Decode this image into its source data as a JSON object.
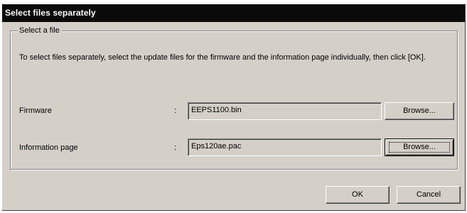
{
  "window": {
    "title": "Select files separately"
  },
  "group": {
    "legend": "Select a file"
  },
  "instruction": "To select files separately, select the update files for the firmware and the information page individually, then click [OK].",
  "rows": [
    {
      "label": "Firmware",
      "colon": ":",
      "value": "EEPS1100.bin",
      "browse_label": "Browse..."
    },
    {
      "label": "Information page",
      "colon": ":",
      "value": "Eps120ae.pac",
      "browse_label": "Browse..."
    }
  ],
  "footer": {
    "ok_label": "OK",
    "cancel_label": "Cancel"
  },
  "colors": {
    "titlebar": "#0a0a0a",
    "face": "#d4d0c8"
  }
}
